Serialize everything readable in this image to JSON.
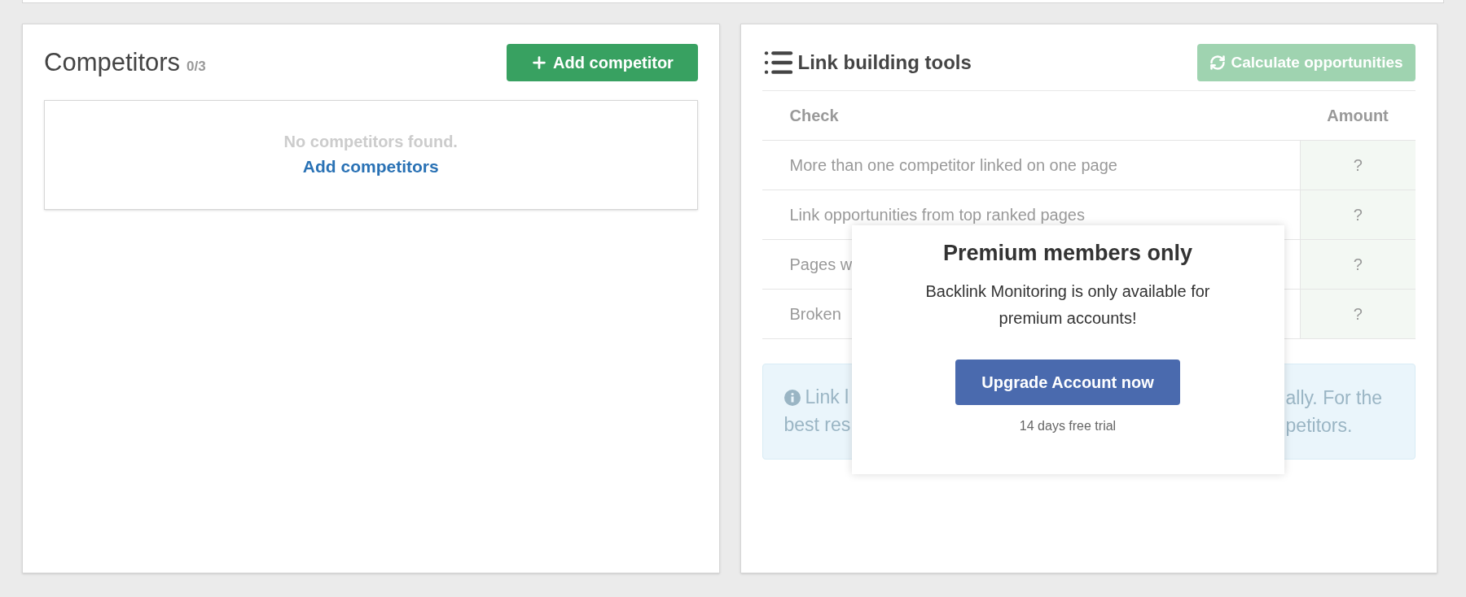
{
  "competitors": {
    "title": "Competitors",
    "count": "0/3",
    "add_button": {
      "label": "Add competitor",
      "disabled": false
    },
    "empty_state": {
      "message": "No competitors found.",
      "link": "Add competitors"
    }
  },
  "link_building": {
    "title": "Link building tools",
    "calculate_button": {
      "label": "Calculate opportunities",
      "disabled": true
    },
    "table": {
      "columns": [
        "Check",
        "Amount"
      ],
      "rows": [
        {
          "check": "More than one competitor linked on one page",
          "amount": "?"
        },
        {
          "check": "Link opportunities from top ranked pages",
          "amount": "?"
        },
        {
          "check": "Pages w",
          "amount": "?"
        },
        {
          "check": "Broken",
          "amount": "?"
        }
      ]
    },
    "info": {
      "left_lines": [
        "Link l",
        "best res"
      ],
      "right_lines": [
        "ally. For the",
        "petitors."
      ]
    }
  },
  "popup": {
    "title": "Premium members only",
    "message": "Backlink Monitoring is only available for premium accounts!",
    "button": "Upgrade Account now",
    "note": "14 days free trial"
  }
}
